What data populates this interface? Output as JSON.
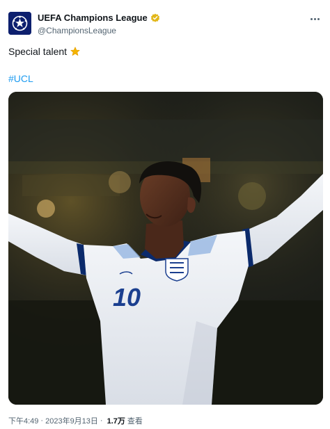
{
  "account": {
    "display_name": "UEFA Champions League",
    "handle": "@ChampionsLeague",
    "avatar_icon": "starball-logo",
    "verified_icon": "gold-verified-badge",
    "verified_color": "#e2b719"
  },
  "tweet": {
    "text": "Special talent",
    "emoji_icon": "star-emoji",
    "hashtag": "#UCL",
    "hashtag_color": "#1d9bf0"
  },
  "media": {
    "kind": "photo",
    "shirt_number": "10"
  },
  "meta": {
    "time": "下午4:49",
    "separator": "·",
    "date": "2023年9月13日",
    "views_count": "1.7万",
    "views_label": "查看"
  },
  "menu": {
    "more_icon": "more-options-icon"
  }
}
